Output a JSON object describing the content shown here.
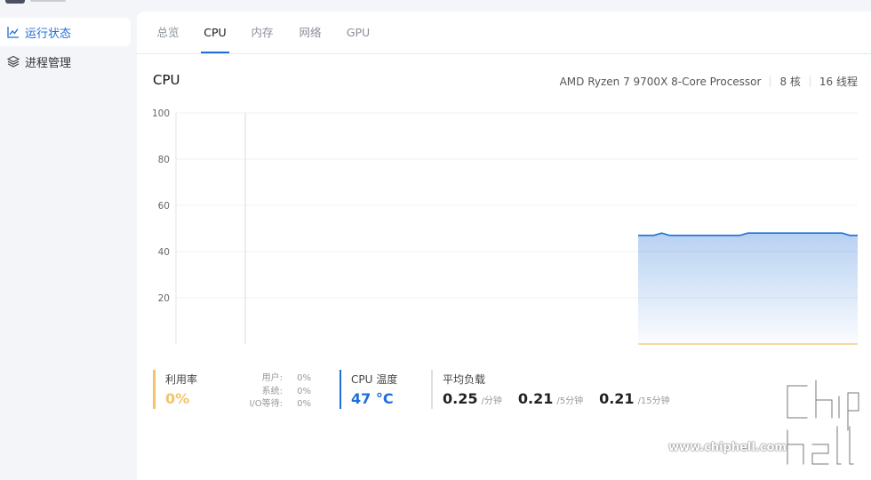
{
  "sidebar": {
    "items": [
      {
        "label": "运行状态",
        "icon": "line-chart-icon",
        "active": true
      },
      {
        "label": "进程管理",
        "icon": "layers-icon",
        "active": false
      }
    ]
  },
  "tabs": [
    {
      "label": "总览",
      "active": false
    },
    {
      "label": "CPU",
      "active": true
    },
    {
      "label": "内存",
      "active": false
    },
    {
      "label": "网络",
      "active": false
    },
    {
      "label": "GPU",
      "active": false
    }
  ],
  "cpu": {
    "heading": "CPU",
    "model": "AMD Ryzen 7 9700X 8-Core Processor",
    "cores": "8 核",
    "threads": "16 线程"
  },
  "chart_data": {
    "type": "area",
    "title": "",
    "xlabel": "",
    "ylabel": "",
    "ylim": [
      0,
      100
    ],
    "yticks": [
      20,
      40,
      60,
      80,
      100
    ],
    "grid": true,
    "series": [
      {
        "color": "#1f6fd6",
        "values": [
          47,
          47,
          47,
          48,
          47,
          47,
          47,
          47,
          47,
          47,
          47,
          47,
          47,
          47,
          48,
          48,
          48,
          48,
          48,
          48,
          48,
          48,
          48,
          48,
          48,
          48,
          48,
          47,
          47
        ]
      },
      {
        "color": "#f3c46b",
        "values": [
          0,
          0,
          0,
          0,
          0,
          0,
          0,
          0,
          0,
          0,
          0,
          0,
          0,
          0,
          0,
          0,
          0,
          0,
          0,
          0,
          0,
          0,
          0,
          0,
          0,
          0,
          0,
          0,
          0
        ]
      }
    ]
  },
  "stats": {
    "usage_label": "利用率",
    "usage_value": "0%",
    "breakdown": [
      {
        "label": "用户:",
        "value": "0%"
      },
      {
        "label": "系统:",
        "value": "0%"
      },
      {
        "label": "I/O等待:",
        "value": "0%"
      }
    ],
    "temp_label": "CPU 温度",
    "temp_value": "47 °C",
    "load_label": "平均负载",
    "load": [
      {
        "value": "0.25",
        "unit": "/分钟"
      },
      {
        "value": "0.21",
        "unit": "/5分钟"
      },
      {
        "value": "0.21",
        "unit": "/15分钟"
      }
    ]
  },
  "watermark": {
    "text": "www.chiphell.com"
  },
  "colors": {
    "accent": "#1f6fd6",
    "usage": "#f3c46b"
  }
}
